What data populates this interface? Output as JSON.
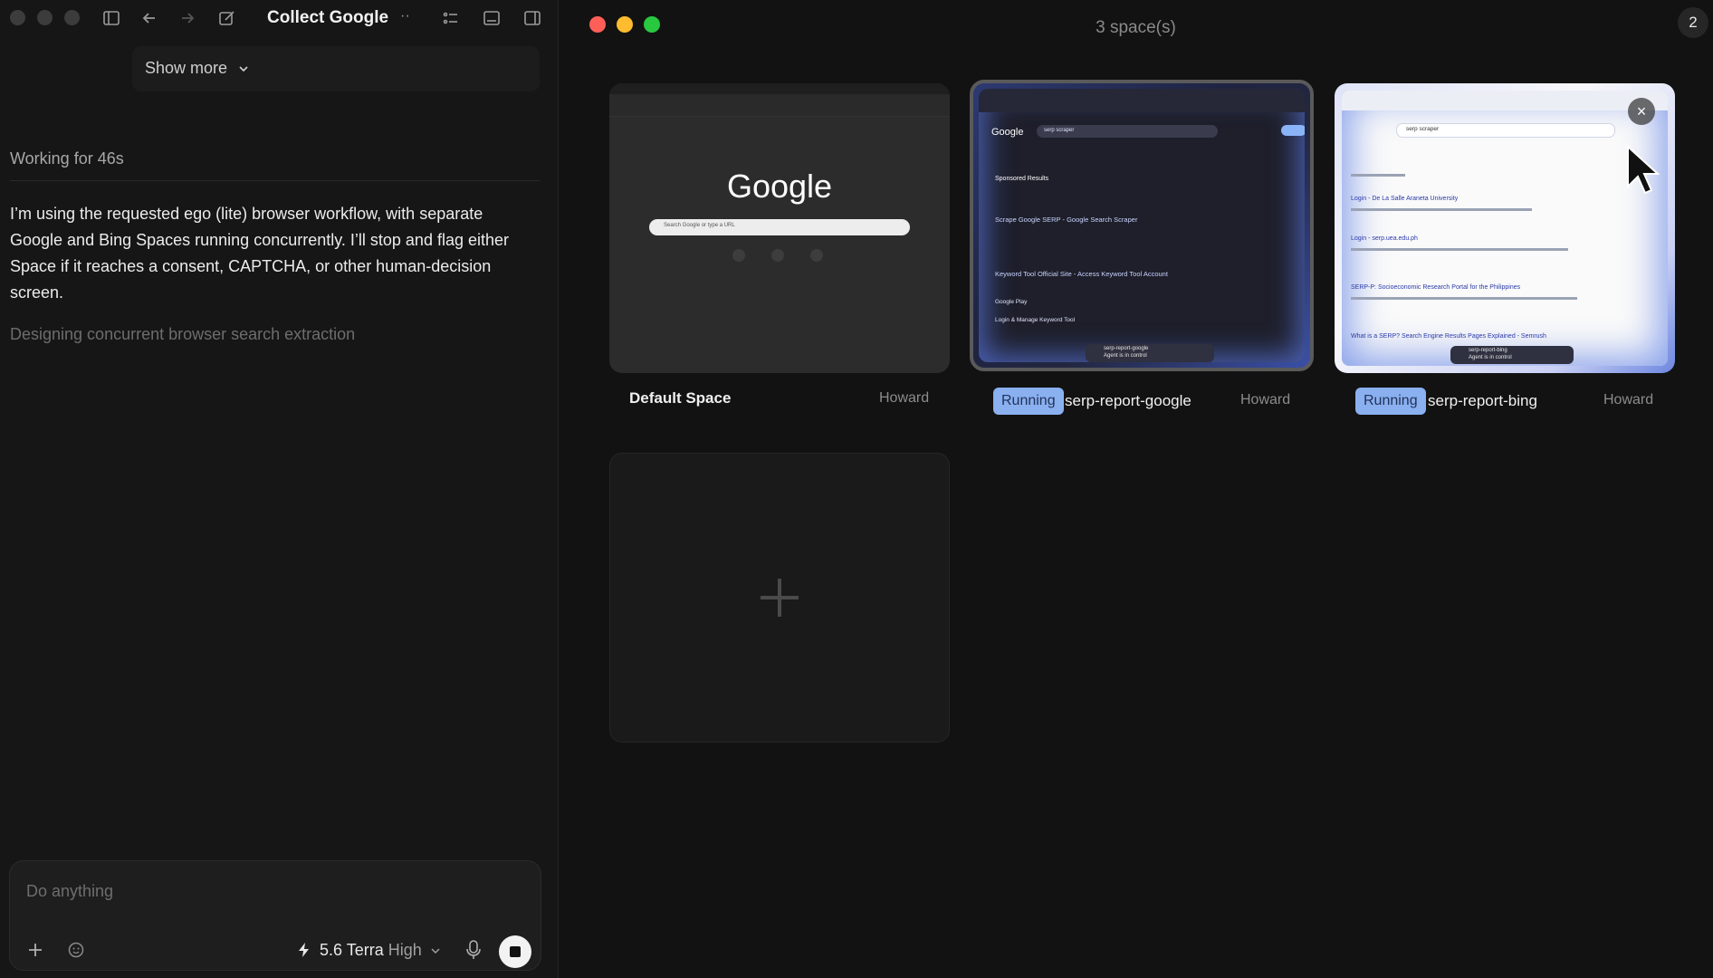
{
  "left_panel": {
    "title": "Collect Google E",
    "title_overflow": "··",
    "show_more_label": "Show more",
    "working_label": "Working for 46s",
    "message": "I’m using the requested ego (lite) browser workflow, with separate Google and Bing Spaces running concurrently. I’ll stop and flag either Space if it reaches a consent, CAPTCHA, or other human-decision screen.",
    "status_line": "Designing concurrent browser search extraction",
    "composer": {
      "placeholder": "Do anything",
      "model": "5.6 Terra",
      "effort": "High"
    }
  },
  "right_panel": {
    "spaces_count": "3 space(s)",
    "badge": "2",
    "close_symbol": "×",
    "spaces": [
      {
        "name": "Default Space",
        "owner": "Howard",
        "status": "",
        "thumbnail": {
          "logo": "Google",
          "search_placeholder": "Search Google or type a URL"
        }
      },
      {
        "name": "serp-report-google",
        "owner": "Howard",
        "status": "Running",
        "thumbnail": {
          "logo": "Google",
          "query": "serp scraper",
          "section": "Sponsored Results",
          "result_1": "Scrape Google SERP - Google Search Scraper",
          "result_2": "Keyword Tool Official Site - Access Keyword Tool Account",
          "link_1": "Google Play",
          "link_2": "Login & Manage Keyword Tool",
          "agent_space": "serp-report-google",
          "agent_status": "Agent is in control"
        }
      },
      {
        "name": "serp-report-bing",
        "owner": "Howard",
        "status": "Running",
        "thumbnail": {
          "query": "serp scraper",
          "result_1": "Login - De La Salle Araneta University",
          "result_2": "Login - serp.uea.edu.ph",
          "result_3": "SERP-P: Socioeconomic Research Portal for the Philippines",
          "result_4": "What is a SERP? Search Engine Results Pages Explained - Semrush",
          "agent_space": "serp-report-bing",
          "agent_status": "Agent is in control"
        }
      }
    ],
    "new_space_symbol": "+"
  },
  "colors": {
    "running_badge": "#8ab0f0",
    "traffic_red": "#ff5f57",
    "traffic_yellow": "#febc2e",
    "traffic_green": "#28c840",
    "panel_bg": "#161616"
  },
  "icons": [
    "sidebar-toggle-icon",
    "back-arrow-icon",
    "forward-arrow-icon",
    "compose-icon",
    "task-list-icon",
    "terminal-icon",
    "panel-icon",
    "chevron-down-icon",
    "plus-icon",
    "emoji-icon",
    "bolt-icon",
    "microphone-icon",
    "stop-icon",
    "close-icon",
    "cursor-icon"
  ]
}
